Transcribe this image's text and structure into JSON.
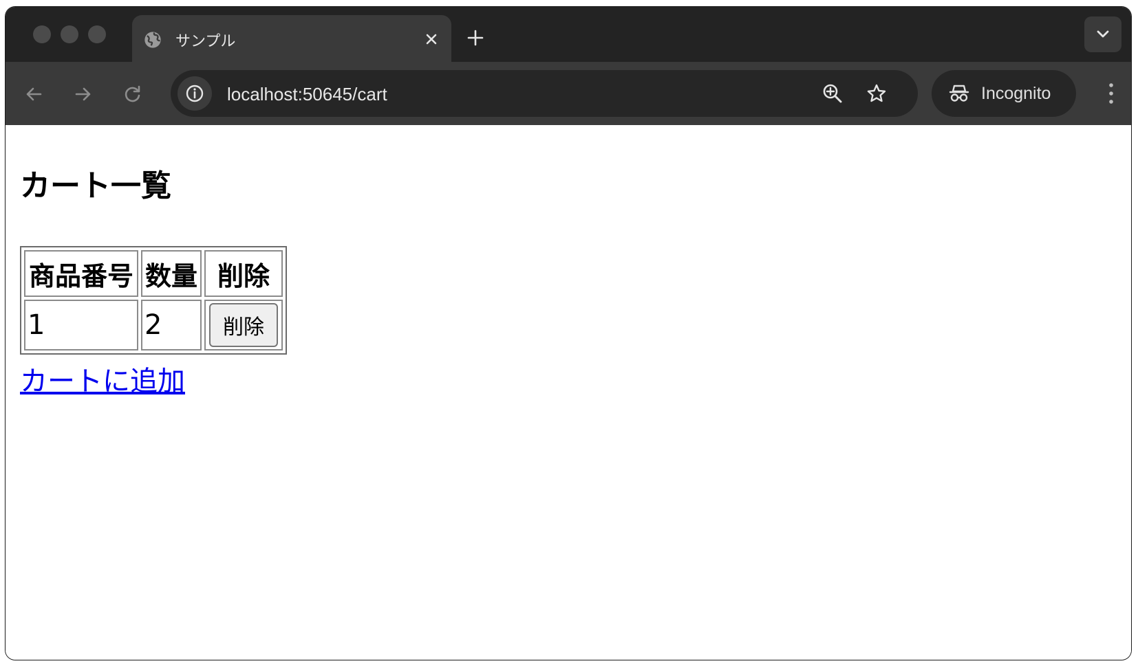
{
  "browser": {
    "tab": {
      "title": "サンプル"
    },
    "address_bar": {
      "url": "localhost:50645/cart"
    },
    "profile": {
      "label": "Incognito"
    },
    "theme": {
      "chrome_dark": "#232323",
      "toolbar": "#3a3a3a",
      "omnibox": "#262626",
      "link": "#0000ee"
    },
    "icons": [
      "globe-icon",
      "close-icon",
      "plus-icon",
      "chevron-down-icon",
      "back-arrow-icon",
      "forward-arrow-icon",
      "reload-icon",
      "info-icon",
      "zoom-icon",
      "star-icon",
      "incognito-icon",
      "more-vert-icon"
    ]
  },
  "page": {
    "heading": "カート一覧",
    "table": {
      "headers": [
        "商品番号",
        "数量",
        "削除"
      ],
      "rows": [
        {
          "product_id": "1",
          "quantity": "2",
          "delete_label": "削除"
        }
      ]
    },
    "add_link": "カートに追加"
  }
}
